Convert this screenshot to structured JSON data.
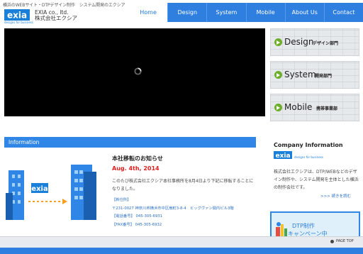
{
  "header": {
    "tagline": "横浜のWEBサイト・DTPデザイン制作　システム開発のエクシア",
    "logo_text": "exia",
    "logo_sub": "designs for business",
    "company_en": "EXIA co., ltd.",
    "company_ja": "株式会社エクシア"
  },
  "nav": {
    "items": [
      {
        "label": "Home"
      },
      {
        "label": "Design"
      },
      {
        "label": "System"
      },
      {
        "label": "Mobile"
      },
      {
        "label": "About Us"
      },
      {
        "label": "Contact"
      }
    ]
  },
  "side": {
    "design": {
      "title": "Design",
      "sub": "デザイン部門"
    },
    "system": {
      "title": "System",
      "sub": "開発部門"
    },
    "mobile": {
      "title": "Mobile",
      "sub": "携帯事業部"
    }
  },
  "info": {
    "heading": "Information",
    "news_title": "本社移転のお知らせ",
    "news_date": "Aug. 4th, 2014",
    "news_body": "このたび株式会社エクシア本社事務所を8月4日より下記に移転することになりました。",
    "lines": [
      "【新住所】",
      "〒231-0027 神奈川県横浜市中区扇町3-8-4　ビッグヴァン関内ビル3階",
      "【電話番号】 045-305-6931",
      "【FAX番号】 045-305-6932"
    ]
  },
  "company_info": {
    "title": "Company Information",
    "logo_text": "exia",
    "logo_sub": "designs for business",
    "desc": "株式会社エクシアは、DTP/WEBなどのデザイン制作や、システム開発を主体とした横浜の制作会社です。",
    "more": ">>> 続きを読む"
  },
  "banner": {
    "line1": "DTP制作",
    "line2": "キャンペーン中"
  },
  "footer": {
    "page_top": "PAGE TOP"
  },
  "colors": {
    "accent": "#2f7fe0",
    "date_red": "#e02020",
    "arrow_green": "#6fae2a"
  }
}
